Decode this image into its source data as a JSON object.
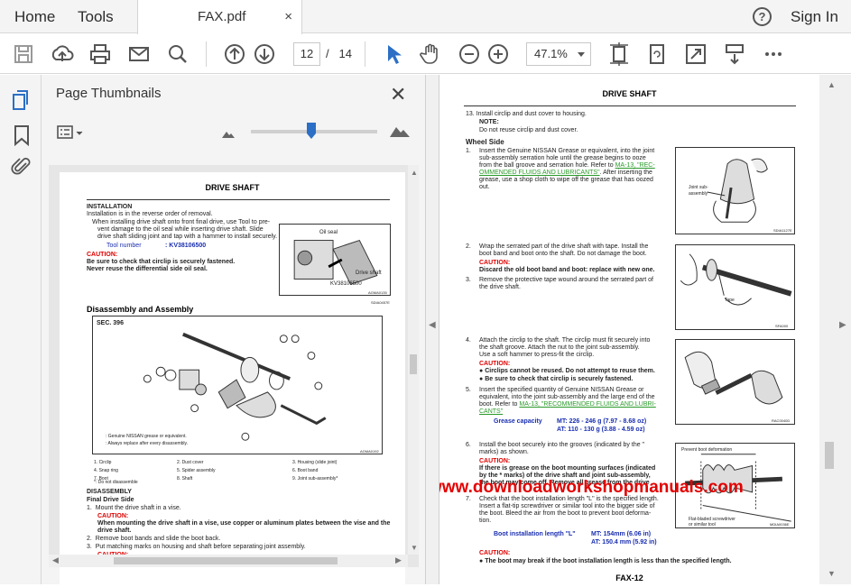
{
  "topbar": {
    "home": "Home",
    "tools": "Tools",
    "tab_title": "FAX.pdf",
    "tab_close": "×",
    "help": "?",
    "sign_in": "Sign In"
  },
  "toolbar": {
    "page_current": "12",
    "page_sep": "/",
    "page_total": "14",
    "zoom": "47.1%"
  },
  "panel": {
    "title": "Page Thumbnails",
    "close": "✕"
  },
  "thumb": {
    "title": "DRIVE SHAFT",
    "installation": "INSTALLATION",
    "install_line1": "Installation is in the reverse order of removal.",
    "install_line2": "When installing drive shaft onto front final drive, use Tool to pre-",
    "install_line3": "vent damage to the oil seal while inserting drive shaft. Slide",
    "install_line4": "drive shaft sliding joint and tap with a hammer to install securely.",
    "tool_label": "Tool number",
    "tool_number": ": KV38106500",
    "caution": "CAUTION:",
    "caution_1": "Be sure to check that circlip is securely fastened.",
    "caution_2": "Never reuse the differential side oil seal.",
    "fig1_oilseal": "Oil seal",
    "fig1_driveshaft": "Drive shaft",
    "fig1_tool": "KV38106500",
    "fig1_code": "AGMA0135",
    "fig1_ref": "SDIA0457E",
    "disassembly_assembly": "Disassembly and Assembly",
    "sec": "SEC. 396",
    "legend_1": ": Genuine NISSAN grease or equivalent.",
    "legend_2": ": Always replace after every disassembly.",
    "fig2_code": "AGMA0192",
    "parts": [
      {
        "num": "1.",
        "name": "Circlip"
      },
      {
        "num": "2.",
        "name": "Dust cover"
      },
      {
        "num": "3.",
        "name": "Housing (slide joint)"
      },
      {
        "num": "4.",
        "name": "Snap ring"
      },
      {
        "num": "5.",
        "name": "Spider assembly"
      },
      {
        "num": "6.",
        "name": "Boot band"
      },
      {
        "num": "7.",
        "name": "Boot"
      },
      {
        "num": "8.",
        "name": "Shaft"
      },
      {
        "num": "9.",
        "name": "Joint sub-assembly*"
      }
    ],
    "do_not_disassemble": "*: Do not disassemble",
    "disassembly": "DISASSEMBLY",
    "final_drive_side": "Final Drive Side",
    "step1": "Mount the drive shaft in a vise.",
    "step1_caution_text": "When mounting the drive shaft in a vise, use copper or aluminum plates between the vise and the",
    "step1_caution_text2": "drive shaft.",
    "step2": "Remove boot bands and slide the boot back.",
    "step3": "Put matching marks on housing and shaft before separating joint assembly."
  },
  "main": {
    "title": "DRIVE SHAFT",
    "s13": "Install circlip and dust cover to housing.",
    "note": "NOTE:",
    "note_text": "Do not reuse circlip and dust cover.",
    "wheel_side": "Wheel Side",
    "w1a": "Insert the Genuine NISSAN Grease or equivalent, into the joint",
    "w1b": "sub-assembly serration hole until the grease begins to ooze",
    "w1c": "from the ball groove and serration hole. Refer to",
    "w1_link": "MA-13, \"REC-",
    "w1_link2": "OMMENDED FLUIDS AND LUBRICANTS\"",
    "w1d": ". After inserting the",
    "w1e": "grease, use a shop cloth to wipe off the grease that has oozed",
    "w1f": "out.",
    "fig_a_label": "Joint sub-\nassembly",
    "fig_a_label1": "Joint sub-",
    "fig_a_label2": "assembly",
    "fig_a_code": "SDIA1127E",
    "w2a": "Wrap the serrated part of the drive shaft with tape. Install the",
    "w2b": "boot band and boot onto the shaft. Do not damage the boot.",
    "w2_caution_text": "Discard the old boot band and boot: replace with new one.",
    "w3a": "Remove the protective tape wound around the serrated part of",
    "w3b": "the drive shaft.",
    "fig_b_label": "Tape",
    "fig_b_code": "SFA000",
    "w4a": "Attach the circlip to the shaft. The circlip must fit securely into",
    "w4b": "the shaft groove. Attach the nut to the joint sub-assembly.",
    "w4c": "Use a soft hammer to press-fit the circlip.",
    "w4_caution_1": "Circlips cannot be reused. Do not attempt to reuse them.",
    "w4_caution_2": "Be sure to check that circlip is securely fastened.",
    "w5a": "Insert the specified quantity of Genuine NISSAN Grease or",
    "w5b": "equivalent, into the joint sub-assembly and the large end of the",
    "w5c": "boot. Refer to",
    "w5_link": "MA-13, \"RECOMMENDED FLUIDS AND LUBRI-",
    "w5_link2": "CANTS\"",
    "grease_capacity": "Grease capacity",
    "grease_mt": "MT: 226 - 246 g (7.97 - 8.68 oz)",
    "grease_at": "AT: 110 - 130 g (3.88 - 4.59 oz)",
    "fig_c_code": "RAC0040D",
    "w6a": "Install the boot securely into the grooves (indicated by the \"",
    "w6b": "marks) as shown.",
    "w6_caution_1": "If there is grease on the boot mounting surfaces (indicated",
    "w6_caution_2": "by the * marks) of the drive shaft and joint sub-assembly,",
    "w6_caution_3": "the boot may come off. Remove all grease from the drive",
    "w7a": "Check that the boot installation length \"L\" is the specified length.",
    "w7b": "Insert a flat-tip screwdriver or similar tool into the bigger side of",
    "w7c": "the boot. Bleed the air from the boot to prevent boot deforma-",
    "w7d": "tion.",
    "fig_d_label1": "Prevent boot deformation",
    "fig_d_label2": "Flat-bladed screwdriver",
    "fig_d_label3": "or similar tool",
    "fig_d_code": "MDIA0036E",
    "boot_length_label": "Boot installation length \"L\"",
    "boot_mt": "MT: 154mm (6.06 in)",
    "boot_at": "AT: 150.4 mm (5.92 in)",
    "final_caution": "The boot may break if the boot installation length is less than the specified length.",
    "footer": "FAX-12",
    "watermark": "www.downloadworkshopmanuals.com"
  }
}
